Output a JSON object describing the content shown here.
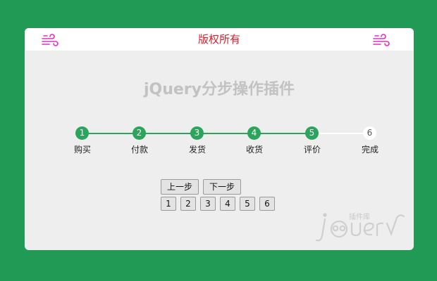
{
  "header": {
    "title": "版权所有",
    "left_icon": "wind-icon",
    "right_icon": "wind-icon",
    "icon_color": "#e62bc8"
  },
  "plugin_title": "jQuery分步操作插件",
  "steps": [
    {
      "number": "1",
      "label": "购买",
      "done": true
    },
    {
      "number": "2",
      "label": "付款",
      "done": true
    },
    {
      "number": "3",
      "label": "发货",
      "done": true
    },
    {
      "number": "4",
      "label": "收货",
      "done": true
    },
    {
      "number": "5",
      "label": "评价",
      "done": true
    },
    {
      "number": "6",
      "label": "完成",
      "done": false
    }
  ],
  "controls": {
    "prev_label": "上一步",
    "next_label": "下一步",
    "page_buttons": [
      "1",
      "2",
      "3",
      "4",
      "5",
      "6"
    ]
  },
  "watermark": {
    "brand": "插件库",
    "icon": "jquery-logo-icon"
  },
  "colors": {
    "background": "#219a55",
    "step_done": "#2aa55b",
    "title_red": "#d5222e"
  }
}
